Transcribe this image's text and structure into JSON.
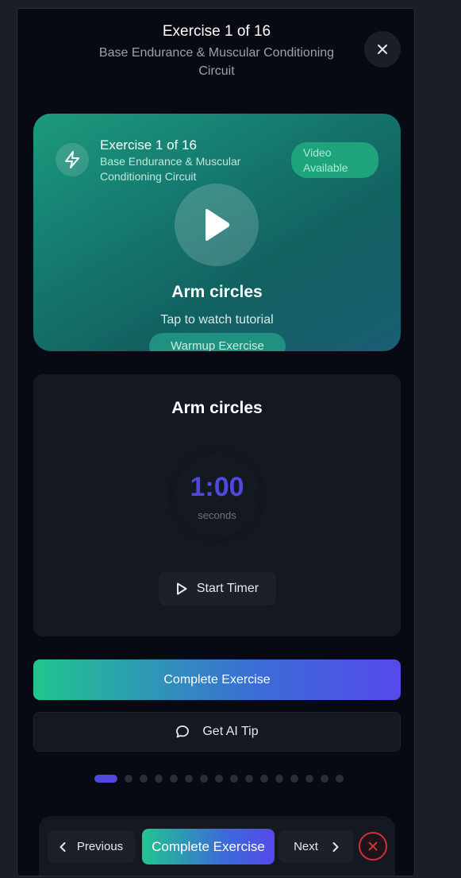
{
  "header": {
    "title": "Exercise 1 of 16",
    "subtitle": "Base Endurance & Muscular Conditioning Circuit"
  },
  "hero": {
    "title": "Exercise 1 of 16",
    "subtitle": "Base Endurance & Muscular Conditioning Circuit",
    "video_badge": "Video Available",
    "exercise_name": "Arm circles",
    "tap_text": "Tap to watch tutorial",
    "category_badge": "Warmup Exercise"
  },
  "timer": {
    "exercise_name": "Arm circles",
    "value": "1:00",
    "unit": "seconds",
    "start_label": "Start Timer"
  },
  "actions": {
    "complete_label": "Complete Exercise",
    "ai_tip_label": "Get AI Tip"
  },
  "progress": {
    "current": 1,
    "total": 16
  },
  "bottom_nav": {
    "previous_label": "Previous",
    "complete_label": "Complete Exercise",
    "next_label": "Next"
  },
  "colors": {
    "accent": "#5148e0",
    "success": "#21c58f",
    "danger": "#d42e3a"
  },
  "icons": {
    "close": "close-icon",
    "bolt": "lightning-bolt-icon",
    "play": "play-icon",
    "chat": "chat-bubble-icon",
    "prev": "chevron-left-icon",
    "next": "chevron-right-icon",
    "exit": "exit-x-icon"
  }
}
